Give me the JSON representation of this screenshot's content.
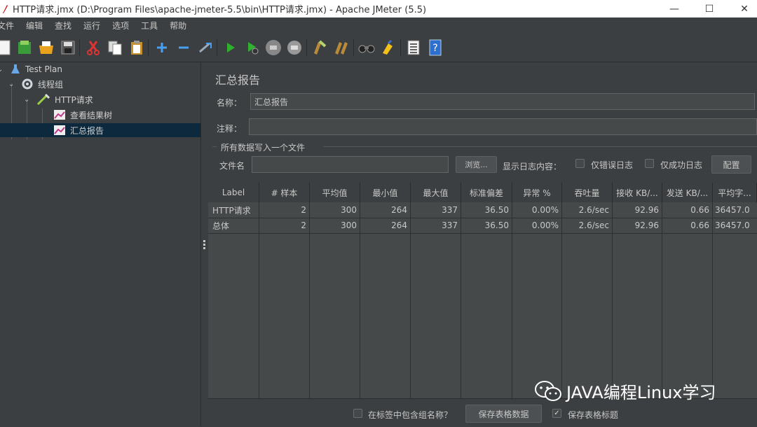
{
  "window": {
    "title": "HTTP请求.jmx (D:\\Program Files\\apache-jmeter-5.5\\bin\\HTTP请求.jmx) - Apache JMeter (5.5)",
    "minimize": "—",
    "maximize": "☐",
    "close": "✕"
  },
  "menu": [
    "文件",
    "编辑",
    "查找",
    "运行",
    "选项",
    "工具",
    "帮助"
  ],
  "toolbar": {
    "icons": [
      "new-icon",
      "templates-icon",
      "open-icon",
      "save-icon",
      "cut-icon",
      "copy-icon",
      "paste-icon",
      "expand-icon",
      "collapse-icon",
      "toggle-icon",
      "start-icon",
      "start-no-pause-icon",
      "stop-icon",
      "shutdown-icon",
      "clear-icon",
      "clear-all-icon",
      "search-icon",
      "reset-search-icon",
      "function-helper-icon",
      "help-icon"
    ]
  },
  "tree": {
    "items": [
      {
        "label": "Test Plan",
        "icon": "flask-icon"
      },
      {
        "label": "线程组",
        "icon": "gear-icon"
      },
      {
        "label": "HTTP请求",
        "icon": "pipette-icon"
      },
      {
        "label": "查看结果树",
        "icon": "graph-icon"
      },
      {
        "label": "汇总报告",
        "icon": "graph-icon"
      }
    ]
  },
  "panel": {
    "title": "汇总报告",
    "name_label": "名称：",
    "name_value": "汇总报告",
    "comment_label": "注释：",
    "comment_value": "",
    "group_title": "所有数据写入一个文件",
    "filename_label": "文件名",
    "filename_value": "",
    "browse_button": "浏览...",
    "log_content_label": "显示日志内容：",
    "errors_only_label": "仅错误日志",
    "success_only_label": "仅成功日志",
    "configure_button": "配置"
  },
  "table": {
    "headers": [
      "Label",
      "# 样本",
      "平均值",
      "最小值",
      "最大值",
      "标准偏差",
      "异常 %",
      "吞吐量",
      "接收 KB/...",
      "发送 KB/...",
      "平均字..."
    ],
    "rows": [
      [
        "HTTP请求",
        "2",
        "300",
        "264",
        "337",
        "36.50",
        "0.00%",
        "2.6/sec",
        "92.96",
        "0.66",
        "36457.0"
      ],
      [
        "总体",
        "2",
        "300",
        "264",
        "337",
        "36.50",
        "0.00%",
        "2.6/sec",
        "92.96",
        "0.66",
        "36457.0"
      ]
    ]
  },
  "bottom": {
    "include_group_name_label": "在标签中包含组名称？",
    "save_table_data_button": "保存表格数据",
    "save_table_header_label": "保存表格标题",
    "save_table_header_checked": true,
    "include_group_name_checked": false
  },
  "watermark": {
    "text": "JAVA编程Linux学习"
  }
}
